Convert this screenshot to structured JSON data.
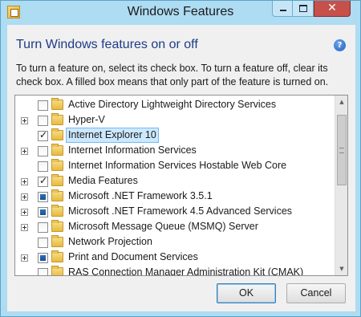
{
  "window": {
    "title": "Windows Features",
    "close_glyph": "✕"
  },
  "header": {
    "heading": "Turn Windows features on or off",
    "help_glyph": "?",
    "instructions": "To turn a feature on, select its check box. To turn a feature off, clear its check box. A filled box means that only part of the feature is turned on."
  },
  "features": [
    {
      "label": "Active Directory Lightweight Directory Services",
      "expandable": false,
      "state": "unchecked",
      "selected": false
    },
    {
      "label": "Hyper-V",
      "expandable": true,
      "state": "unchecked",
      "selected": false
    },
    {
      "label": "Internet Explorer 10",
      "expandable": false,
      "state": "checked",
      "selected": true
    },
    {
      "label": "Internet Information Services",
      "expandable": true,
      "state": "unchecked",
      "selected": false
    },
    {
      "label": "Internet Information Services Hostable Web Core",
      "expandable": false,
      "state": "unchecked",
      "selected": false
    },
    {
      "label": "Media Features",
      "expandable": true,
      "state": "checked",
      "selected": false
    },
    {
      "label": "Microsoft .NET Framework 3.5.1",
      "expandable": true,
      "state": "partial",
      "selected": false
    },
    {
      "label": "Microsoft .NET Framework 4.5 Advanced Services",
      "expandable": true,
      "state": "partial",
      "selected": false
    },
    {
      "label": "Microsoft Message Queue (MSMQ) Server",
      "expandable": true,
      "state": "unchecked",
      "selected": false
    },
    {
      "label": "Network Projection",
      "expandable": false,
      "state": "unchecked",
      "selected": false
    },
    {
      "label": "Print and Document Services",
      "expandable": true,
      "state": "partial",
      "selected": false
    },
    {
      "label": "RAS Connection Manager Administration Kit (CMAK)",
      "expandable": false,
      "state": "unchecked",
      "selected": false
    }
  ],
  "buttons": {
    "ok": "OK",
    "cancel": "Cancel"
  },
  "icons": {
    "app": "windows-features-icon",
    "help": "help-icon",
    "folder": "folder-icon",
    "expand": "expand-plus-icon"
  },
  "colors": {
    "frame": "#aedcf2",
    "heading": "#1e3b87",
    "selection": "#cce8ff",
    "close_button": "#c7504a"
  }
}
